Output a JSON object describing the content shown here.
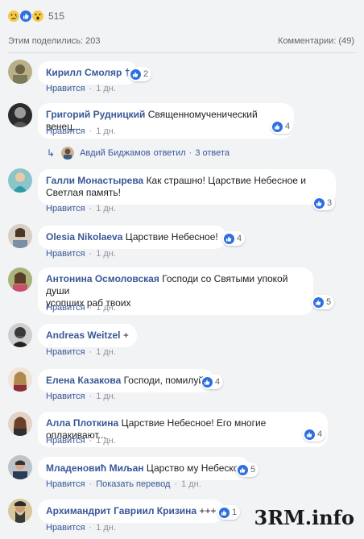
{
  "reactions": {
    "count": "515",
    "icons": [
      "sad-icon",
      "like-icon",
      "wow-icon"
    ]
  },
  "meta": {
    "shares": "Этим поделились: 203",
    "comments": "Комментарии: (49)"
  },
  "labels": {
    "like": "Нравится",
    "time": "1 дн.",
    "translate": "Показать перевод"
  },
  "colors": {
    "link": "#385898",
    "like_blue": "#2d6fe0",
    "background": "#f2f3f5"
  },
  "comments": [
    {
      "author": "Кирилл Смоляр †",
      "text": "",
      "likes": "2"
    },
    {
      "author": "Григорий Рудницкий",
      "text": "Священномученический венец...",
      "likes": "4"
    },
    {
      "author": "Галли Монастырева",
      "text": "Как страшно! Царствие Небесное и",
      "text2": "Светлая память!",
      "likes": "3"
    },
    {
      "author": "Olesia Nikolaeva",
      "text": "Царствие Небесное!",
      "likes": "4"
    },
    {
      "author": "Антонина Осмоловская",
      "text": "Господи со Святыми упокой души",
      "text2": "усопших раб твоих",
      "likes": "5"
    },
    {
      "author": "Andreas Weitzel",
      "text": "+",
      "likes": ""
    },
    {
      "author": "Елена Казакова",
      "text": "Господи, помилуй!",
      "likes": "4"
    },
    {
      "author": "Алла Плоткина",
      "text": "Царствие Небесное! Его многие оплакивают...",
      "likes": "4"
    },
    {
      "author": "Младеновић Миљан",
      "text": "Царство му Небеско.",
      "likes": "5"
    },
    {
      "author": "Архимандрит Гавриил Кризина",
      "text": "+++",
      "likes": "1"
    }
  ],
  "reply": {
    "author": "Авдий Биджамов",
    "verb": "ответил",
    "count": "3 ответа"
  },
  "watermark": "3RM.info"
}
